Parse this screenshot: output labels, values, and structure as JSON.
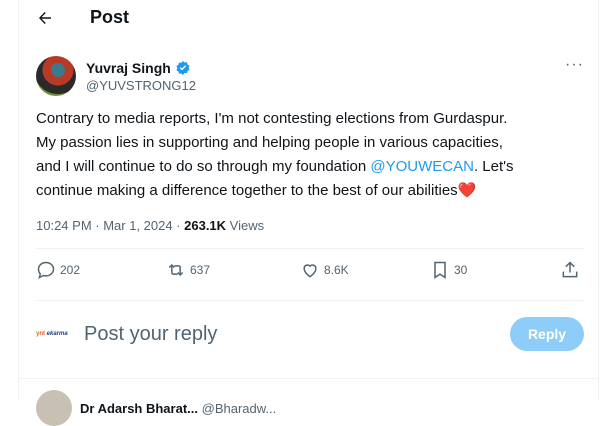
{
  "header": {
    "title": "Post"
  },
  "tweet": {
    "author_name": "Yuvraj Singh",
    "author_handle": "@YUVSTRONG12",
    "text_line1": "Contrary to media reports, I'm not contesting elections from Gurdaspur.",
    "text_line2": "My passion lies in supporting and helping people in various capacities,",
    "text_line3_pre": "and I will continue to do so through my foundation ",
    "mention": "@YOUWECAN",
    "text_line3_post": ". Let's",
    "text_line4": "continue making a difference together to the best of our abilities",
    "heart_emoji": "❤️",
    "timestamp": "10:24 PM · Mar 1, 2024 · ",
    "views_count": "263.1K",
    "views_label": " Views"
  },
  "actions": {
    "replies": "202",
    "retweets": "637",
    "likes": "8.6K",
    "bookmarks": "30"
  },
  "reply": {
    "placeholder": "Post your reply",
    "button_label": "Reply",
    "logo_text_1": "ynt",
    "logo_text_2": "ekarma"
  },
  "next_reply": {
    "name": "Dr Adarsh Bharat...",
    "handle": "@Bharadw..."
  },
  "colors": {
    "accent": "#1d9bf0",
    "reply_button": "#8ecdf7",
    "muted": "#536471"
  }
}
